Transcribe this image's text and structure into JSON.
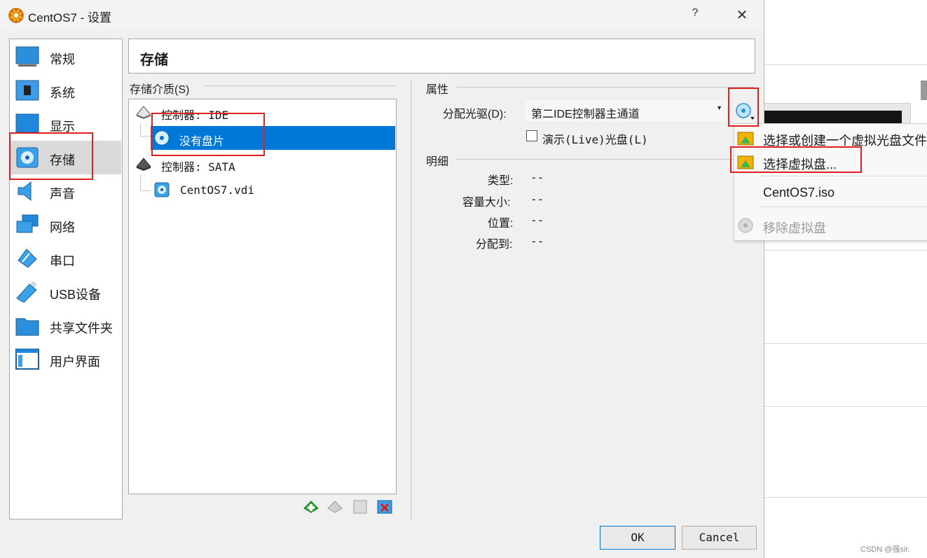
{
  "window": {
    "title": "CentOS7 - 设置",
    "help": "?",
    "close": "✕"
  },
  "nav": {
    "items": [
      {
        "label": "常规"
      },
      {
        "label": "系统"
      },
      {
        "label": "显示"
      },
      {
        "label": "存储"
      },
      {
        "label": "声音"
      },
      {
        "label": "网络"
      },
      {
        "label": "串口"
      },
      {
        "label": "USB设备"
      },
      {
        "label": "共享文件夹"
      },
      {
        "label": "用户界面"
      }
    ],
    "selected": "存储"
  },
  "page": {
    "title": "存储"
  },
  "storage": {
    "group_label": "存储介质(S)",
    "tree": [
      {
        "label": "控制器: IDE"
      },
      {
        "label": "没有盘片"
      },
      {
        "label": "控制器: SATA"
      },
      {
        "label": "CentOS7.vdi"
      }
    ]
  },
  "attributes": {
    "group_label": "属性",
    "drive_label": "分配光驱(D):",
    "drive_value": "第二IDE控制器主通道",
    "live_label": "演示(Live)光盘(L)",
    "live_checked": false
  },
  "details": {
    "group_label": "明细",
    "rows": [
      {
        "label": "类型:",
        "value": "--"
      },
      {
        "label": "容量大小:",
        "value": "--"
      },
      {
        "label": "位置:",
        "value": "--"
      },
      {
        "label": "分配到:",
        "value": "--"
      }
    ]
  },
  "menu": {
    "items": [
      {
        "label": "选择或创建一个虚拟光盘文件"
      },
      {
        "label": "选择虚拟盘..."
      },
      {
        "label": "CentOS7.iso"
      },
      {
        "label": "移除虚拟盘"
      }
    ]
  },
  "buttons": {
    "ok": "OK",
    "cancel": "Cancel"
  },
  "watermark": "CSDN @强sir.",
  "colors": {
    "selection": "#0078d7",
    "highlight": "#e02020"
  }
}
